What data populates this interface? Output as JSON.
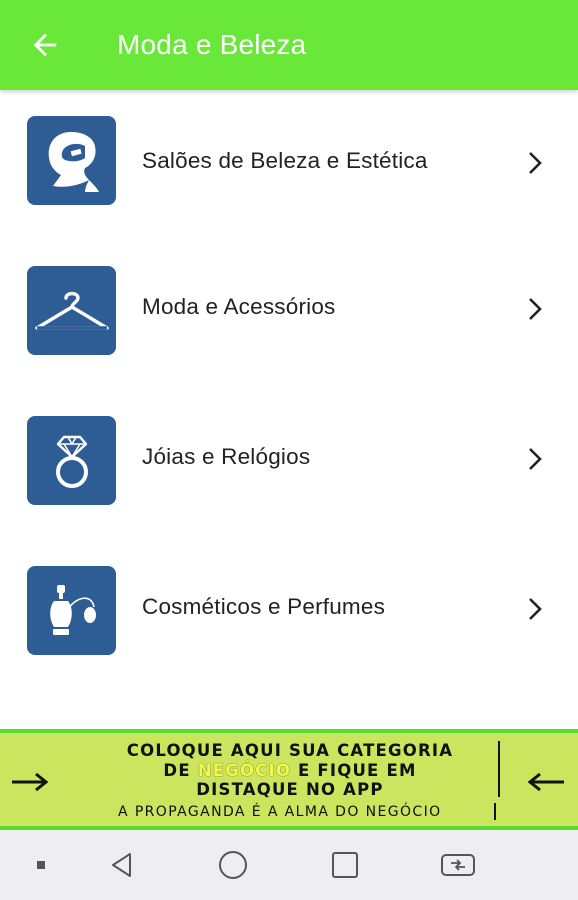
{
  "header": {
    "title": "Moda e Beleza",
    "back_icon": "arrow-back-icon",
    "background": "#6ae83a"
  },
  "categories": [
    {
      "label": "Salões de Beleza e Estética",
      "icon": "salon-head-icon"
    },
    {
      "label": "Moda e Acessórios",
      "icon": "hanger-icon"
    },
    {
      "label": "Jóias e Relógios",
      "icon": "ring-icon"
    },
    {
      "label": "Cosméticos e Perfumes",
      "icon": "perfume-icon"
    }
  ],
  "tile_color": "#2e5c95",
  "banner": {
    "line1": "COLOQUE AQUI  SUA CATEGORIA",
    "line2_a": "DE ",
    "line2_highlight": "NEGÓCIO",
    "line2_b": " E FIQUE EM",
    "line3": "DISTAQUE NO APP",
    "tagline": "A PROPAGANDA É A ALMA DO NEGÓCIO",
    "background": "#cbe65e"
  },
  "navbar": {
    "icons": [
      "menu-dot-icon",
      "back-triangle-icon",
      "home-circle-icon",
      "recents-square-icon",
      "rotate-screen-icon"
    ]
  }
}
